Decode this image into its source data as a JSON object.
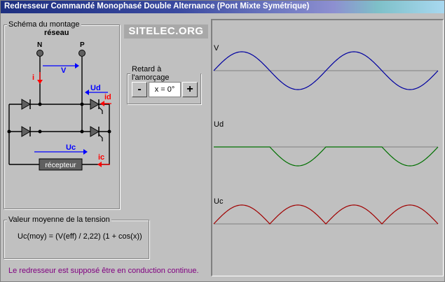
{
  "window": {
    "title": "Redresseur Commandé Monophasé Double Alternance (Pont Mixte Symétrique)"
  },
  "logo": "SITELEC.ORG",
  "schema": {
    "legend": "Schéma du montage",
    "network_label": "réseau",
    "node_n": "N",
    "node_p": "P",
    "label_i": "i",
    "label_v": "V",
    "label_ud": "Ud",
    "label_id": "id",
    "label_uc": "Uc",
    "label_ic": "ic",
    "receiver_label": "récepteur"
  },
  "delay": {
    "legend": "Retard à l'amorçage",
    "minus_label": "-",
    "plus_label": "+",
    "value": "x = 0°"
  },
  "average": {
    "legend": "Valeur moyenne de la tension",
    "formula": "Uc(moy) = (V(eff) / 2,22) (1 + cos(x))"
  },
  "note": "Le redresseur est supposé être en conduction continue.",
  "scope": {
    "traces": [
      {
        "label": "V",
        "color": "#0000a0"
      },
      {
        "label": "Ud",
        "color": "#007000"
      },
      {
        "label": "Uc",
        "color": "#a00000"
      }
    ]
  },
  "colors": {
    "blue": "#0000ff",
    "red": "#ff0000",
    "receiver_fill": "#606060"
  }
}
